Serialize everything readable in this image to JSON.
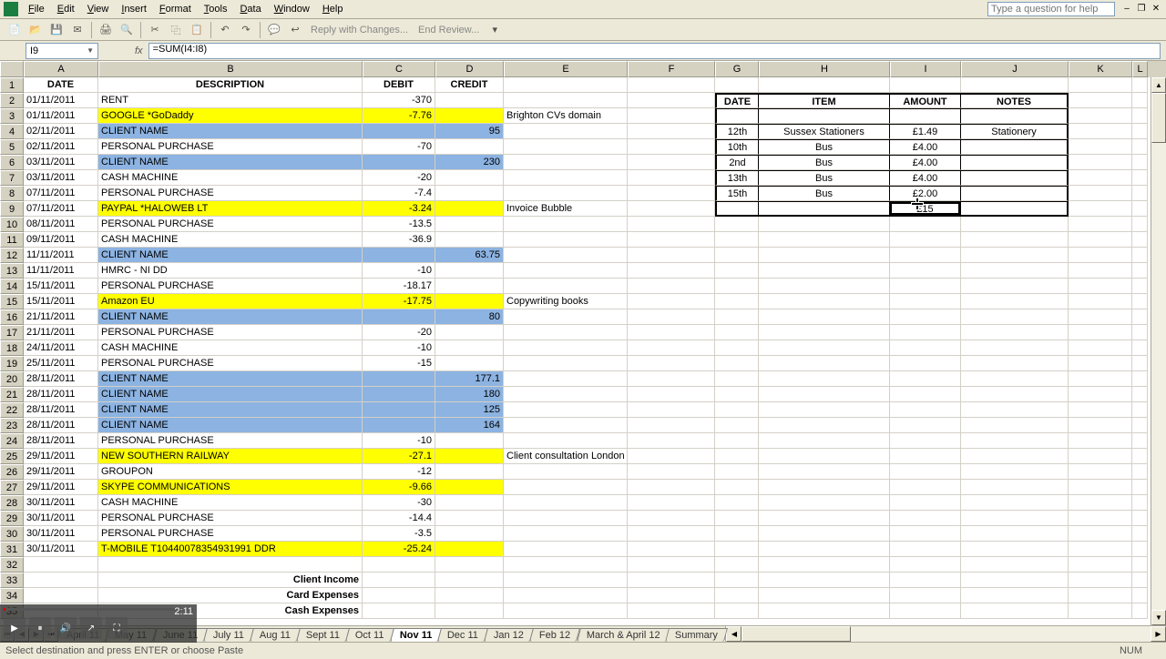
{
  "menu": [
    "File",
    "Edit",
    "View",
    "Insert",
    "Format",
    "Tools",
    "Data",
    "Window",
    "Help"
  ],
  "help_placeholder": "Type a question for help",
  "toolbar": {
    "reply": "Reply with Changes...",
    "end_review": "End Review..."
  },
  "name_box": "I9",
  "formula": "=SUM(I4:I8)",
  "columns": [
    "A",
    "B",
    "C",
    "D",
    "E",
    "F",
    "G",
    "H",
    "I",
    "J",
    "K",
    "L"
  ],
  "headers": {
    "A": "DATE",
    "B": "DESCRIPTION",
    "C": "DEBIT",
    "D": "CREDIT"
  },
  "side_headers": {
    "G": "DATE",
    "H": "ITEM",
    "I": "AMOUNT",
    "J": "NOTES"
  },
  "rows": [
    {
      "n": 2,
      "A": "01/11/2011",
      "B": "RENT",
      "C": "-370",
      "D": "",
      "E": "",
      "hl": "",
      "G": "",
      "H": "",
      "I": "",
      "J": "",
      "side": "header"
    },
    {
      "n": 3,
      "A": "01/11/2011",
      "B": "GOOGLE *GoDaddy",
      "C": "-7.76",
      "D": "",
      "E": "Brighton CVs domain",
      "hl": "yellow",
      "G": "",
      "H": "",
      "I": "",
      "J": ""
    },
    {
      "n": 4,
      "A": "02/11/2011",
      "B": "CLIENT NAME",
      "C": "",
      "D": "95",
      "E": "",
      "hl": "blue",
      "G": "12th",
      "H": "Sussex Stationers",
      "I": "£1.49",
      "J": "Stationery"
    },
    {
      "n": 5,
      "A": "02/11/2011",
      "B": "PERSONAL PURCHASE",
      "C": "-70",
      "D": "",
      "E": "",
      "hl": "",
      "G": "10th",
      "H": "Bus",
      "I": "£4.00",
      "J": ""
    },
    {
      "n": 6,
      "A": "03/11/2011",
      "B": "CLIENT NAME",
      "C": "",
      "D": "230",
      "E": "",
      "hl": "blue",
      "G": "2nd",
      "H": "Bus",
      "I": "£4.00",
      "J": ""
    },
    {
      "n": 7,
      "A": "03/11/2011",
      "B": "CASH MACHINE",
      "C": "-20",
      "D": "",
      "E": "",
      "hl": "",
      "G": "13th",
      "H": "Bus",
      "I": "£4.00",
      "J": ""
    },
    {
      "n": 8,
      "A": "07/11/2011",
      "B": "PERSONAL PURCHASE",
      "C": "-7.4",
      "D": "",
      "E": "",
      "hl": "",
      "G": "15th",
      "H": "Bus",
      "I": "£2.00",
      "J": ""
    },
    {
      "n": 9,
      "A": "07/11/2011",
      "B": "PAYPAL *HALOWEB LT",
      "C": "-3.24",
      "D": "",
      "E": "Invoice Bubble",
      "hl": "yellow",
      "G": "",
      "H": "",
      "I": "£15",
      "J": "",
      "active": true
    },
    {
      "n": 10,
      "A": "08/11/2011",
      "B": "PERSONAL PURCHASE",
      "C": "-13.5",
      "D": "",
      "E": "",
      "hl": ""
    },
    {
      "n": 11,
      "A": "09/11/2011",
      "B": "CASH MACHINE",
      "C": "-36.9",
      "D": "",
      "E": "",
      "hl": ""
    },
    {
      "n": 12,
      "A": "11/11/2011",
      "B": "CLIENT NAME",
      "C": "",
      "D": "63.75",
      "E": "",
      "hl": "blue"
    },
    {
      "n": 13,
      "A": "11/11/2011",
      "B": "HMRC - NI DD",
      "C": "-10",
      "D": "",
      "E": "",
      "hl": ""
    },
    {
      "n": 14,
      "A": "15/11/2011",
      "B": "PERSONAL PURCHASE",
      "C": "-18.17",
      "D": "",
      "E": "",
      "hl": ""
    },
    {
      "n": 15,
      "A": "15/11/2011",
      "B": "Amazon EU",
      "C": "-17.75",
      "D": "",
      "E": "Copywriting books",
      "hl": "yellow"
    },
    {
      "n": 16,
      "A": "21/11/2011",
      "B": "CLIENT NAME",
      "C": "",
      "D": "80",
      "E": "",
      "hl": "blue"
    },
    {
      "n": 17,
      "A": "21/11/2011",
      "B": "PERSONAL PURCHASE",
      "C": "-20",
      "D": "",
      "E": "",
      "hl": ""
    },
    {
      "n": 18,
      "A": "24/11/2011",
      "B": "CASH MACHINE",
      "C": "-10",
      "D": "",
      "E": "",
      "hl": ""
    },
    {
      "n": 19,
      "A": "25/11/2011",
      "B": "PERSONAL PURCHASE",
      "C": "-15",
      "D": "",
      "E": "",
      "hl": ""
    },
    {
      "n": 20,
      "A": "28/11/2011",
      "B": "CLIENT NAME",
      "C": "",
      "D": "177.1",
      "E": "",
      "hl": "blue"
    },
    {
      "n": 21,
      "A": "28/11/2011",
      "B": "CLIENT NAME",
      "C": "",
      "D": "180",
      "E": "",
      "hl": "blue"
    },
    {
      "n": 22,
      "A": "28/11/2011",
      "B": "CLIENT NAME",
      "C": "",
      "D": "125",
      "E": "",
      "hl": "blue"
    },
    {
      "n": 23,
      "A": "28/11/2011",
      "B": "CLIENT NAME",
      "C": "",
      "D": "164",
      "E": "",
      "hl": "blue"
    },
    {
      "n": 24,
      "A": "28/11/2011",
      "B": "PERSONAL PURCHASE",
      "C": "-10",
      "D": "",
      "E": "",
      "hl": ""
    },
    {
      "n": 25,
      "A": "29/11/2011",
      "B": "NEW SOUTHERN RAILWAY",
      "C": "-27.1",
      "D": "",
      "E": "Client consultation London",
      "hl": "yellow"
    },
    {
      "n": 26,
      "A": "29/11/2011",
      "B": "GROUPON",
      "C": "-12",
      "D": "",
      "E": "",
      "hl": ""
    },
    {
      "n": 27,
      "A": "29/11/2011",
      "B": "SKYPE COMMUNICATIONS",
      "C": "-9.66",
      "D": "",
      "E": "",
      "hl": "yellow"
    },
    {
      "n": 28,
      "A": "30/11/2011",
      "B": "CASH MACHINE",
      "C": "-30",
      "D": "",
      "E": "",
      "hl": ""
    },
    {
      "n": 29,
      "A": "30/11/2011",
      "B": "PERSONAL PURCHASE",
      "C": "-14.4",
      "D": "",
      "E": "",
      "hl": ""
    },
    {
      "n": 30,
      "A": "30/11/2011",
      "B": "PERSONAL PURCHASE",
      "C": "-3.5",
      "D": "",
      "E": "",
      "hl": ""
    },
    {
      "n": 31,
      "A": "30/11/2011",
      "B": "T-MOBILE           T10440078354931991 DDR",
      "C": "-25.24",
      "D": "",
      "E": "",
      "hl": "yellow"
    },
    {
      "n": 32,
      "A": "",
      "B": "",
      "C": "",
      "D": "",
      "E": "",
      "hl": ""
    },
    {
      "n": 33,
      "A": "",
      "B": "Client Income",
      "Balign": "r",
      "Bbold": true,
      "C": "",
      "D": "",
      "E": "",
      "hl": ""
    },
    {
      "n": 34,
      "A": "",
      "B": "Card Expenses",
      "Balign": "r",
      "Bbold": true,
      "C": "",
      "D": "",
      "E": "",
      "hl": ""
    },
    {
      "n": 35,
      "A": "",
      "B": "Cash Expenses",
      "Balign": "r",
      "Bbold": true,
      "C": "",
      "D": "",
      "E": "",
      "hl": ""
    }
  ],
  "sheet_tabs": [
    {
      "label": "April 11",
      "active": false
    },
    {
      "label": "May 11",
      "active": false
    },
    {
      "label": "June 11",
      "active": false
    },
    {
      "label": "July 11",
      "active": false
    },
    {
      "label": "Aug 11",
      "active": false
    },
    {
      "label": "Sept 11",
      "active": false
    },
    {
      "label": "Oct 11",
      "active": false
    },
    {
      "label": "Nov 11",
      "active": true
    },
    {
      "label": "Dec 11",
      "active": false
    },
    {
      "label": "Jan 12",
      "active": false
    },
    {
      "label": "Feb 12",
      "active": false
    },
    {
      "label": "March & April 12",
      "active": false
    },
    {
      "label": "Summary",
      "active": false
    }
  ],
  "status": {
    "msg": "Select destination and press ENTER or choose Paste",
    "num": "NUM"
  },
  "media": {
    "time": "2:11"
  }
}
